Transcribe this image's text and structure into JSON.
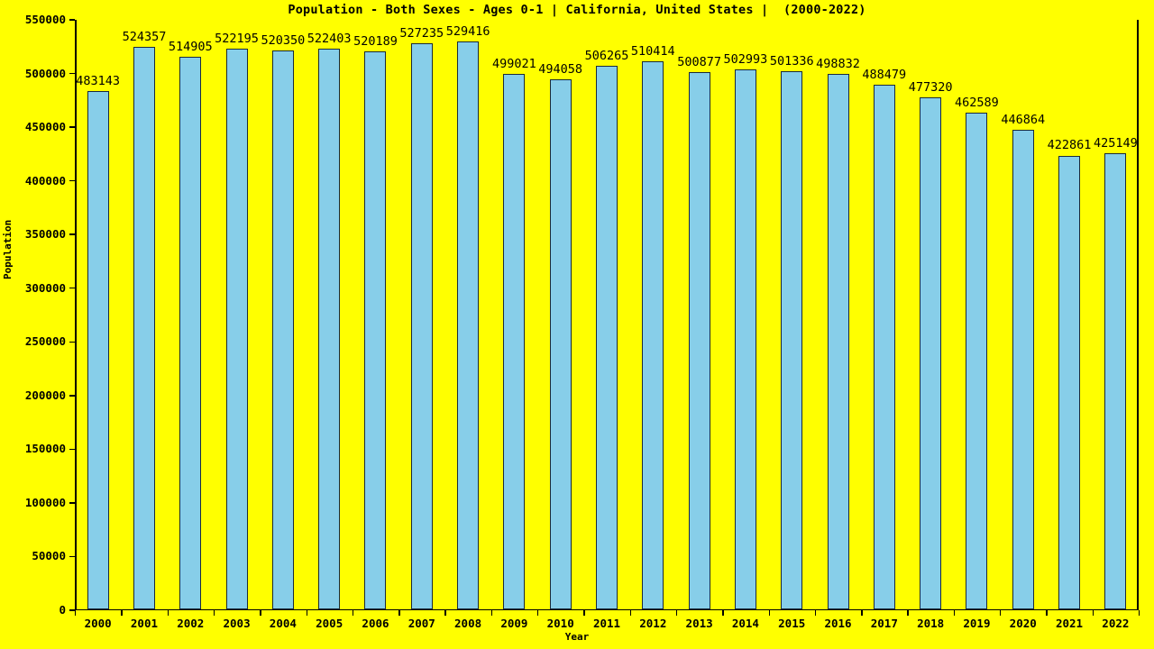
{
  "chart_data": {
    "type": "bar",
    "title": "Population - Both Sexes - Ages 0-1 | California, United States |  (2000-2022)",
    "xlabel": "Year",
    "ylabel": "Population",
    "categories": [
      "2000",
      "2001",
      "2002",
      "2003",
      "2004",
      "2005",
      "2006",
      "2007",
      "2008",
      "2009",
      "2010",
      "2011",
      "2012",
      "2013",
      "2014",
      "2015",
      "2016",
      "2017",
      "2018",
      "2019",
      "2020",
      "2021",
      "2022"
    ],
    "values": [
      483143,
      524357,
      514905,
      522195,
      520350,
      522403,
      520189,
      527235,
      529416,
      499021,
      494058,
      506265,
      510414,
      500877,
      502993,
      501336,
      498832,
      488479,
      477320,
      462589,
      446864,
      422861,
      425149
    ],
    "value_labels": [
      "483143",
      "524357",
      "514905",
      "522195",
      "520350",
      "522403",
      "520189",
      "527235",
      "529416",
      "499021",
      "494058",
      "506265",
      "510414",
      "500877",
      "502993",
      "501336",
      "498832",
      "488479",
      "477320",
      "462589",
      "446864",
      "422861",
      "425149"
    ],
    "ylim": [
      0,
      550000
    ],
    "xlim_note": "23 categorical year slots",
    "yticks": [
      0,
      50000,
      100000,
      150000,
      200000,
      250000,
      300000,
      350000,
      400000,
      450000,
      500000,
      550000
    ],
    "ytick_labels": [
      "0",
      "50000",
      "100000",
      "150000",
      "200000",
      "250000",
      "300000",
      "350000",
      "400000",
      "450000",
      "500000",
      "550000"
    ],
    "grid": false,
    "legend": false,
    "legend_position": "none",
    "colors": {
      "background": "#ffff00",
      "bar_fill": "#87cee9",
      "bar_edge": "#1a2a3a",
      "axis": "#000000",
      "text": "#000000"
    }
  }
}
